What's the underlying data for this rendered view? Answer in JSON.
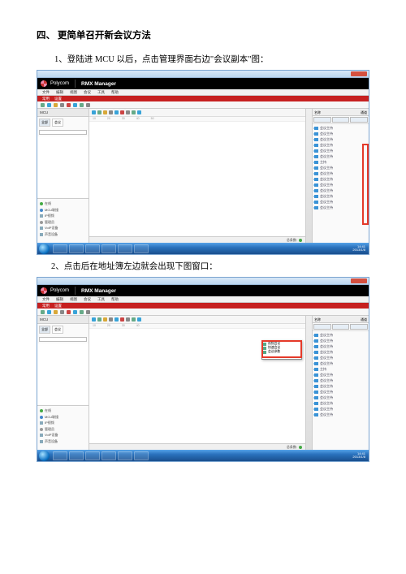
{
  "doc": {
    "section_heading": "四、  更简单召开新会议方法",
    "step1": "1、登陆进 MCU 以后，点击管理界面右边\"会议副本\"图：",
    "step2": "2、点击后在地址簿左边就会出现下图窗口："
  },
  "app": {
    "vendor": "Polycom",
    "title": "RMX Manager",
    "menubar": [
      "文件",
      "编辑",
      "视图",
      "会议",
      "工具",
      "帮助"
    ],
    "redband_items": [
      "常用",
      "设置"
    ],
    "ruler_marks": [
      "10",
      "20",
      "30",
      "40",
      "50"
    ],
    "left_tabs": [
      "全部",
      "会议"
    ],
    "left_header": "MCU",
    "footer_label": "总条数:",
    "right_header_left": "名称",
    "right_header_right": "通道",
    "right_items": [
      "会议主持",
      "会议主持",
      "会议主持",
      "会议主持",
      "会议主持",
      "会议主持",
      "主持",
      "会议主持",
      "会议主持",
      "会议主持",
      "会议主持",
      "会议主持",
      "会议主持",
      "会议主持",
      "会议主持"
    ],
    "left_bottom_items": [
      "在线",
      "MCU联接",
      "IP视频",
      "管理员",
      "VoIP设备",
      "声音设备"
    ],
    "dropdown_items": [
      "视频会议",
      "快速会议",
      "会议参数"
    ],
    "clock_time": "14:41",
    "clock_date": "2013/1/8"
  }
}
